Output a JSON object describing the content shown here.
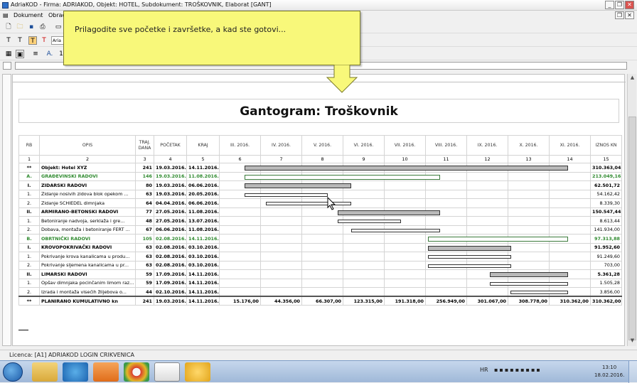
{
  "window": {
    "title": "AdriaKOD - Firma: ADRIAKOD,  Objekt: HOTEL,  Subdokument: TROŠKOVNIK,  Elaborat [GANT]",
    "minimize": "_",
    "restore": "❐",
    "close": "✕"
  },
  "menu": {
    "dokument": "Dokument",
    "obrada": "Obrad"
  },
  "toolbar2": {
    "t1": "T",
    "t2": "T",
    "t3": "T",
    "t4": "T",
    "font": "Aria"
  },
  "toolbar3": {
    "a": "A.",
    "n": "1"
  },
  "tooltip": {
    "text": "Prilagodite sve početke i završetke, a kad ste gotovi..."
  },
  "gantt": {
    "title": "Gantogram: Troškovnik",
    "headers": {
      "rb": "RB",
      "opis": "OPIS",
      "traj": "TRAJ. DANA",
      "pocetak": "POČETAK",
      "kraj": "KRAJ",
      "months": [
        "III. 2016.",
        "IV. 2016.",
        "V. 2016.",
        "VI. 2016.",
        "VII. 2016.",
        "VIII. 2016.",
        "IX. 2016.",
        "X. 2016.",
        "XI. 2016."
      ],
      "iznos": "IZNOS KN"
    },
    "colnums": [
      "1",
      "2",
      "3",
      "4",
      "5",
      "6",
      "7",
      "8",
      "9",
      "10",
      "11",
      "12",
      "13",
      "14",
      "15"
    ],
    "rows": [
      {
        "rb": "**",
        "opis": "Objekt: Hotel XYZ",
        "traj": "241",
        "pocetak": "19.03.2016.",
        "kraj": "14.11.2016.",
        "iznos": "310.363,04",
        "style": "b",
        "bar": "grey",
        "bar_start": "2016-03-19",
        "bar_end": "2016-11-14"
      },
      {
        "rb": "A.",
        "opis": "GRAĐEVINSKI RADOVI",
        "traj": "146",
        "pocetak": "19.03.2016.",
        "kraj": "11.08.2016.",
        "iznos": "213.049,16",
        "style": "bg",
        "bar": "green",
        "bar_start": "2016-03-19",
        "bar_end": "2016-08-11"
      },
      {
        "rb": "I.",
        "opis": "ZIDARSKI RADOVI",
        "traj": "80",
        "pocetak": "19.03.2016.",
        "kraj": "06.06.2016.",
        "iznos": "62.501,72",
        "style": "b",
        "bar": "grey",
        "bar_start": "2016-03-19",
        "bar_end": "2016-06-06"
      },
      {
        "rb": "1.",
        "opis": "Zidanje nosivih zidova blok opekom ...",
        "traj": "63",
        "pocetak": "19.03.2016.",
        "kraj": "20.05.2016.",
        "iznos": "54.162,42",
        "style": "",
        "bar": "white",
        "bar_start": "2016-03-19",
        "bar_end": "2016-05-20"
      },
      {
        "rb": "2.",
        "opis": "Zidanje SCHIEDEL dimnjaka",
        "traj": "64",
        "pocetak": "04.04.2016.",
        "kraj": "06.06.2016.",
        "iznos": "8.339,30",
        "style": "",
        "bar": "white",
        "bar_start": "2016-04-04",
        "bar_end": "2016-06-06"
      },
      {
        "rb": "II.",
        "opis": "ARMIRANO-BETONSKI RADOVI",
        "traj": "77",
        "pocetak": "27.05.2016.",
        "kraj": "11.08.2016.",
        "iznos": "150.547,44",
        "style": "b",
        "bar": "grey",
        "bar_start": "2016-05-27",
        "bar_end": "2016-08-11"
      },
      {
        "rb": "1.",
        "opis": "Betoniranje nadvoja, serklaža i gre...",
        "traj": "48",
        "pocetak": "27.05.2016.",
        "kraj": "13.07.2016.",
        "iznos": "8.613,44",
        "style": "",
        "bar": "white",
        "bar_start": "2016-05-27",
        "bar_end": "2016-07-13"
      },
      {
        "rb": "2.",
        "opis": "Dobava, montaža i betoniranje FERT ...",
        "traj": "67",
        "pocetak": "06.06.2016.",
        "kraj": "11.08.2016.",
        "iznos": "141.934,00",
        "style": "",
        "bar": "white",
        "bar_start": "2016-06-06",
        "bar_end": "2016-08-11"
      },
      {
        "rb": "B.",
        "opis": "OBRTNIČKI RADOVI",
        "traj": "105",
        "pocetak": "02.08.2016.",
        "kraj": "14.11.2016.",
        "iznos": "97.313,88",
        "style": "bg",
        "bar": "green",
        "bar_start": "2016-08-02",
        "bar_end": "2016-11-14"
      },
      {
        "rb": "I.",
        "opis": "KROVOPOKRIVAČKI RADOVI",
        "traj": "63",
        "pocetak": "02.08.2016.",
        "kraj": "03.10.2016.",
        "iznos": "91.952,60",
        "style": "b",
        "bar": "grey",
        "bar_start": "2016-08-02",
        "bar_end": "2016-10-03"
      },
      {
        "rb": "1.",
        "opis": "Pokrivanje krova kanalicama u produ...",
        "traj": "63",
        "pocetak": "02.08.2016.",
        "kraj": "03.10.2016.",
        "iznos": "91.249,60",
        "style": "",
        "bar": "white",
        "bar_start": "2016-08-02",
        "bar_end": "2016-10-03"
      },
      {
        "rb": "2.",
        "opis": "Pokrivanje sljemena kanalicama u pr...",
        "traj": "63",
        "pocetak": "02.08.2016.",
        "kraj": "03.10.2016.",
        "iznos": "703,00",
        "style": "",
        "bar": "white",
        "bar_start": "2016-08-02",
        "bar_end": "2016-10-03"
      },
      {
        "rb": "II.",
        "opis": "LIMARSKI RADOVI",
        "traj": "59",
        "pocetak": "17.09.2016.",
        "kraj": "14.11.2016.",
        "iznos": "5.361,28",
        "style": "b",
        "bar": "grey",
        "bar_start": "2016-09-17",
        "bar_end": "2016-11-14"
      },
      {
        "rb": "1.",
        "opis": "Opšav dimnjaka pocinčanim limom raz...",
        "traj": "59",
        "pocetak": "17.09.2016.",
        "kraj": "14.11.2016.",
        "iznos": "1.505,28",
        "style": "",
        "bar": "white",
        "bar_start": "2016-09-17",
        "bar_end": "2016-11-14"
      },
      {
        "rb": "2.",
        "opis": "Izrada i montaža visećih žlijebova o...",
        "traj": "44",
        "pocetak": "02.10.2016.",
        "kraj": "14.11.2016.",
        "iznos": "3.856,00",
        "style": "",
        "bar": "white",
        "bar_start": "2016-10-02",
        "bar_end": "2016-11-14"
      }
    ],
    "total": {
      "rb": "**",
      "opis": "PLANIRANO KUMULATIVNO kn",
      "traj": "241",
      "pocetak": "19.03.2016.",
      "kraj": "14.11.2016.",
      "months": [
        "15.176,00",
        "44.356,00",
        "66.307,00",
        "123.315,00",
        "191.318,00",
        "256.949,00",
        "301.067,00",
        "308.778,00",
        "310.362,00"
      ],
      "iznos": "310.362,00"
    }
  },
  "status": {
    "licence": "Licenca: [A1] ADRIAKOD LOGIN CRIKVENICA"
  },
  "taskbar": {
    "lang": "HR",
    "time": "13:10",
    "date": "18.02.2016."
  }
}
